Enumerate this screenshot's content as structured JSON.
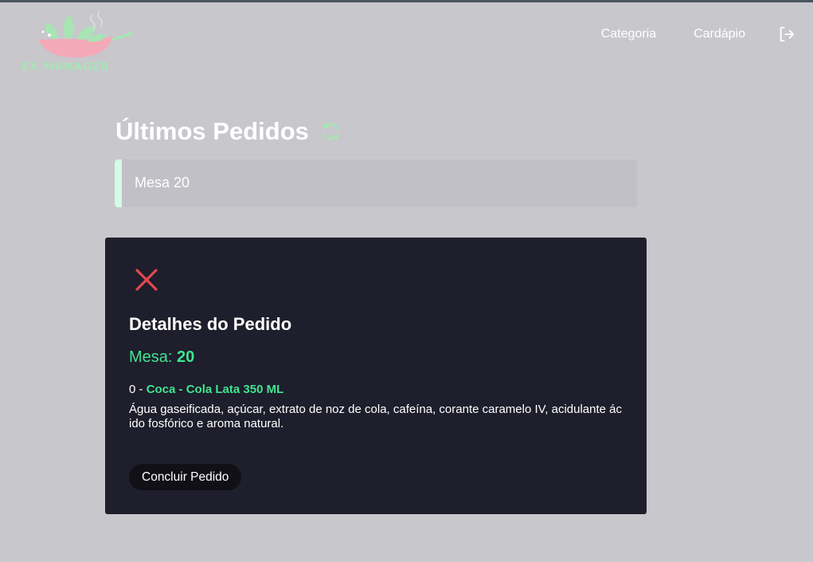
{
  "brand": {
    "logo_text": "EX MANAGER"
  },
  "nav": {
    "category_label": "Categoria",
    "menu_label": "Cardápio",
    "logout_icon": "logout-icon"
  },
  "orders": {
    "title": "Últimos Pedidos",
    "refresh_icon": "refresh-icon",
    "items": [
      {
        "label": "Mesa 20"
      }
    ]
  },
  "modal": {
    "close_icon": "close-icon",
    "title": "Detalhes do Pedido",
    "table_label": "Mesa:",
    "table_number": "20",
    "item": {
      "quantity": "0",
      "separator": " - ",
      "name": "Coca - Cola Lata 350 ML",
      "description": "Água gaseificada, açúcar, extrato de noz de cola, cafeína, corante caramelo IV, acidulante ácido fosfórico e aroma natural."
    },
    "finish_label": "Concluir Pedido"
  },
  "colors": {
    "background": "#c8c7cc",
    "modal_bg": "#1e1e2c",
    "accent_green": "#3fe58f",
    "close_red": "#e5484d",
    "order_accent": "#d4fbe3"
  }
}
